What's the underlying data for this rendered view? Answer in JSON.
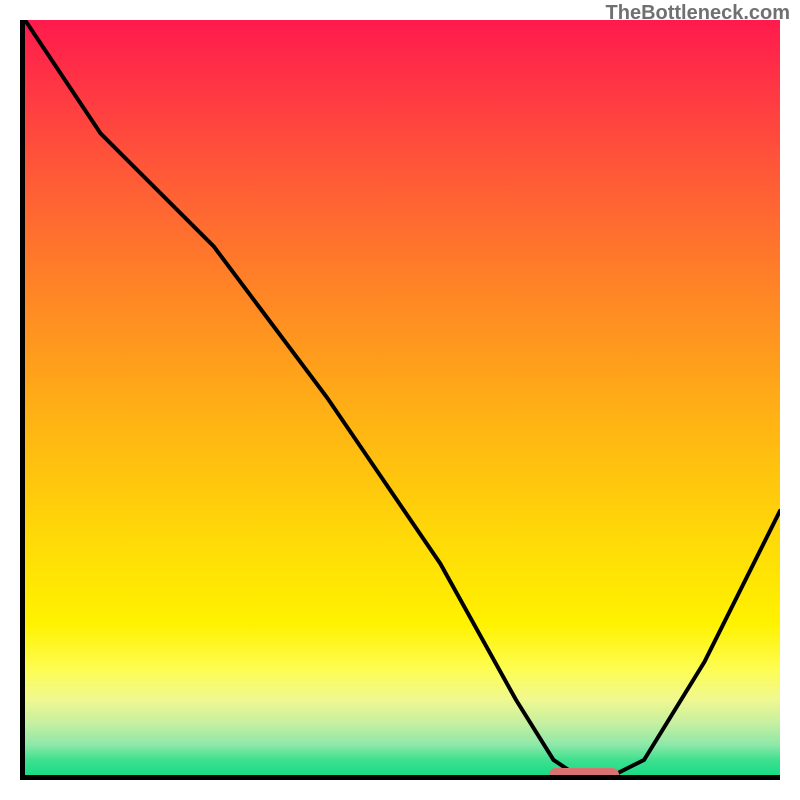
{
  "watermark": "TheBottleneck.com",
  "chart_data": {
    "type": "line",
    "title": "",
    "xlabel": "",
    "ylabel": "",
    "xlim": [
      0,
      100
    ],
    "ylim": [
      0,
      100
    ],
    "x": [
      0,
      10,
      25,
      40,
      55,
      65,
      70,
      73,
      78,
      82,
      90,
      100
    ],
    "values": [
      100,
      85,
      70,
      50,
      28,
      10,
      2,
      0,
      0,
      2,
      15,
      35
    ],
    "marker": {
      "x_start": 70,
      "x_end": 78,
      "y": 0
    },
    "background_gradient": [
      "#ff1a4d",
      "#ff8525",
      "#ffd808",
      "#fdfd52",
      "#18dc85"
    ]
  }
}
